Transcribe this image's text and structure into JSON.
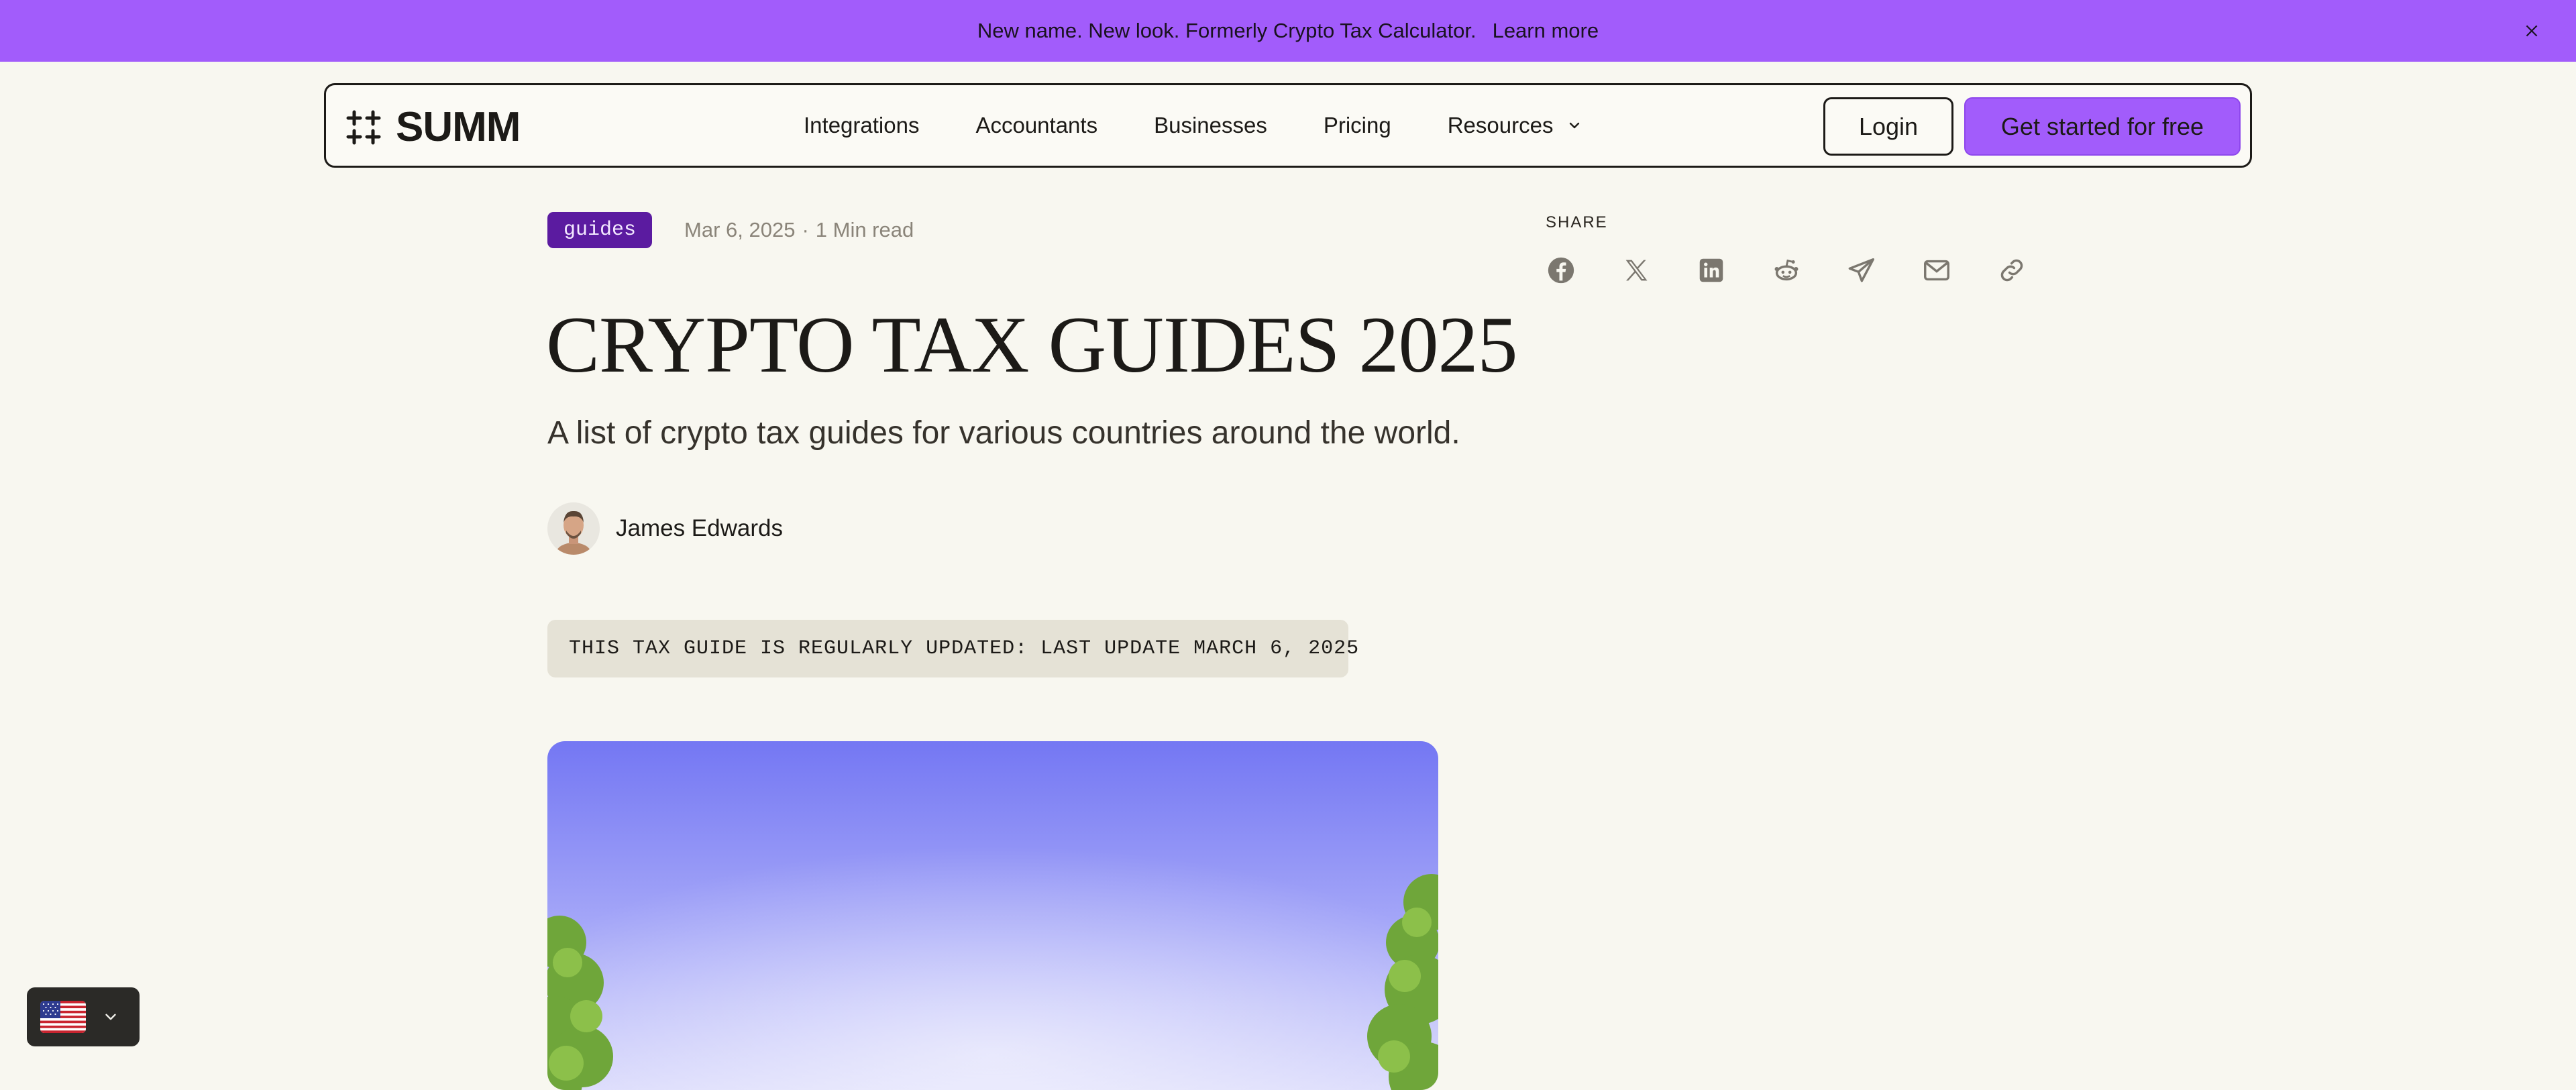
{
  "announcement": {
    "message": "New name. New look. Formerly Crypto Tax Calculator.",
    "link": "Learn more"
  },
  "header": {
    "brand": "SUMM",
    "nav": [
      {
        "label": "Integrations"
      },
      {
        "label": "Accountants"
      },
      {
        "label": "Businesses"
      },
      {
        "label": "Pricing"
      },
      {
        "label": "Resources"
      }
    ],
    "login_label": "Login",
    "cta_label": "Get started for free"
  },
  "article": {
    "tag": "guides",
    "date": "Mar 6, 2025",
    "separator": "·",
    "read_time": "1 Min read",
    "title": "CRYPTO TAX GUIDES 2025",
    "subtitle": "A list of crypto tax guides for various countries around the world.",
    "author": "James Edwards",
    "notice": "THIS TAX GUIDE IS REGULARLY UPDATED: LAST UPDATE MARCH 6, 2025"
  },
  "share": {
    "label": "SHARE",
    "icons": [
      "facebook-icon",
      "x-icon",
      "linkedin-icon",
      "reddit-icon",
      "telegram-icon",
      "mail-icon",
      "link-icon"
    ]
  },
  "colors": {
    "accent": "#a25cfb",
    "tag_bg": "#5b1ba0",
    "background": "#f8f7f0",
    "text": "#1c1a17"
  }
}
